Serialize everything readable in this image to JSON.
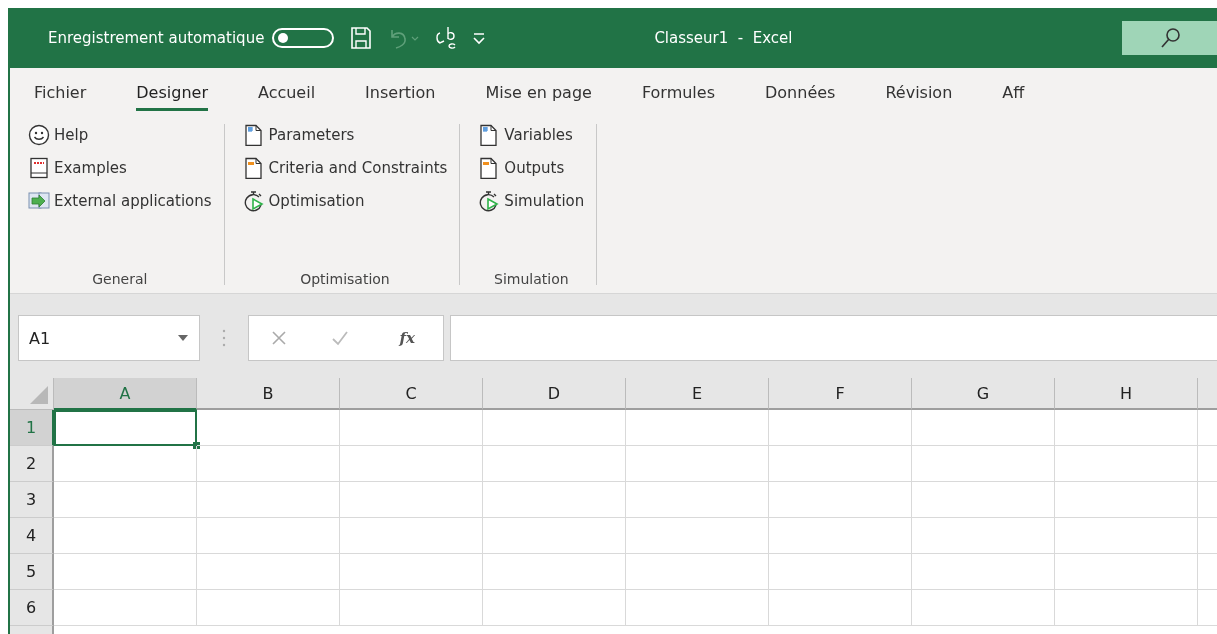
{
  "title_bar": {
    "autosave_label": "Enregistrement automatique",
    "autosave_on": false,
    "title": "Classeur1  -  Excel"
  },
  "ribbon_tabs": [
    {
      "label": "Fichier",
      "selected": false
    },
    {
      "label": "Designer",
      "selected": true
    },
    {
      "label": "Accueil",
      "selected": false
    },
    {
      "label": "Insertion",
      "selected": false
    },
    {
      "label": "Mise en page",
      "selected": false
    },
    {
      "label": "Formules",
      "selected": false
    },
    {
      "label": "Données",
      "selected": false
    },
    {
      "label": "Révision",
      "selected": false
    },
    {
      "label": "Aff",
      "selected": false
    }
  ],
  "ribbon_groups": [
    {
      "label": "General",
      "items": [
        {
          "label": "Help",
          "kind": "smiley"
        },
        {
          "label": "Examples",
          "kind": "book"
        },
        {
          "label": "External applications",
          "kind": "app"
        }
      ]
    },
    {
      "label": "Optimisation",
      "items": [
        {
          "label": "Parameters",
          "kind": "grid-doc"
        },
        {
          "label": "Criteria and Constraints",
          "kind": "tag-doc"
        },
        {
          "label": "Optimisation",
          "kind": "stopwatch"
        }
      ]
    },
    {
      "label": "Simulation",
      "items": [
        {
          "label": "Variables",
          "kind": "grid-doc"
        },
        {
          "label": "Outputs",
          "kind": "tag-doc"
        },
        {
          "label": "Simulation",
          "kind": "stopwatch"
        }
      ]
    }
  ],
  "formula_bar": {
    "name_box": "A1",
    "function_label": "fx"
  },
  "sheet": {
    "columns": [
      {
        "label": "A",
        "selected": true
      },
      {
        "label": "B",
        "selected": false
      },
      {
        "label": "C",
        "selected": false
      },
      {
        "label": "D",
        "selected": false
      },
      {
        "label": "E",
        "selected": false
      },
      {
        "label": "F",
        "selected": false
      },
      {
        "label": "G",
        "selected": false
      },
      {
        "label": "H",
        "selected": false
      }
    ],
    "rows": [
      {
        "label": "1",
        "selected": true
      },
      {
        "label": "2",
        "selected": false
      },
      {
        "label": "3",
        "selected": false
      },
      {
        "label": "4",
        "selected": false
      },
      {
        "label": "5",
        "selected": false
      },
      {
        "label": "6",
        "selected": false
      }
    ]
  }
}
